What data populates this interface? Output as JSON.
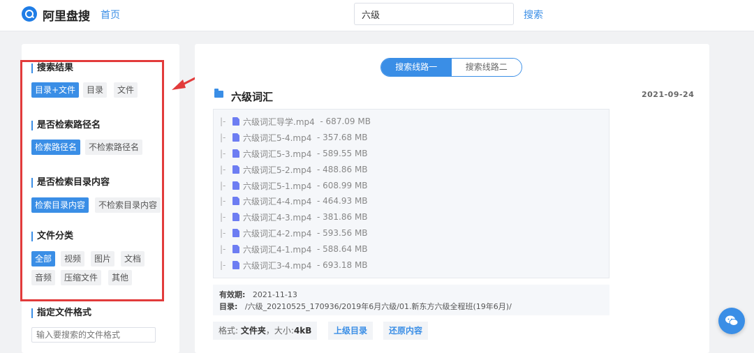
{
  "header": {
    "logo_text": "阿里盘搜",
    "nav_home": "首页",
    "search_value": "六级",
    "search_button": "搜索"
  },
  "sidebar": {
    "sections": [
      {
        "title": "搜索结果",
        "options": [
          "目录+文件",
          "目录",
          "文件"
        ],
        "active": "目录+文件"
      },
      {
        "title": "是否检索路径名",
        "options": [
          "检索路径名",
          "不检索路径名"
        ],
        "active": "检索路径名"
      },
      {
        "title": "是否检索目录内容",
        "options": [
          "检索目录内容",
          "不检索目录内容"
        ],
        "active": "检索目录内容"
      },
      {
        "title": "文件分类",
        "options": [
          "全部",
          "视频",
          "图片",
          "文档",
          "音频",
          "压缩文件",
          "其他"
        ],
        "active": "全部"
      }
    ],
    "format_title": "指定文件格式",
    "format_placeholder": "输入要搜索的文件格式"
  },
  "main": {
    "tabs": [
      "搜索线路一",
      "搜索线路二"
    ],
    "active_tab": "搜索线路一",
    "result_title": "六级词汇",
    "result_date": "2021-09-24",
    "files": [
      {
        "prefix": "|-",
        "name": "六级词汇导学.mp4",
        "size": "- 687.09 MB"
      },
      {
        "prefix": "|-",
        "name": "六级词汇5-4.mp4",
        "size": "- 357.68 MB"
      },
      {
        "prefix": "|-",
        "name": "六级词汇5-3.mp4",
        "size": "- 589.55 MB"
      },
      {
        "prefix": "|-",
        "name": "六级词汇5-2.mp4",
        "size": "- 488.86 MB"
      },
      {
        "prefix": "|-",
        "name": "六级词汇5-1.mp4",
        "size": "- 608.99 MB"
      },
      {
        "prefix": "|-",
        "name": "六级词汇4-4.mp4",
        "size": "- 464.93 MB"
      },
      {
        "prefix": "|-",
        "name": "六级词汇4-3.mp4",
        "size": "- 381.86 MB"
      },
      {
        "prefix": "|-",
        "name": "六级词汇4-2.mp4",
        "size": "- 593.56 MB"
      },
      {
        "prefix": "|-",
        "name": "六级词汇4-1.mp4",
        "size": "- 588.64 MB"
      },
      {
        "prefix": "|-",
        "name": "六级词汇3-4.mp4",
        "size": "- 693.18 MB"
      }
    ],
    "expiry_label": "有效期:",
    "expiry_value": "2021-11-13",
    "dir_label": "目录:",
    "dir_value": "/六级_20210525_170936/2019年6月六级/01.新东方六级全程班(19年6月)/",
    "format_label": "格式:",
    "format_value": "文件夹",
    "size_label": "，大小:",
    "size_value": "4kB",
    "parent_dir_button": "上级目录",
    "restore_button": "还原内容"
  },
  "colors": {
    "accent": "#3a8ee6",
    "highlight": "#e23b3b"
  },
  "icons": {
    "logo": "search-logo-icon",
    "folder": "folder-icon",
    "file": "video-file-icon",
    "chat": "chat-bubble-icon",
    "annotation": "red-arrow-icon"
  }
}
